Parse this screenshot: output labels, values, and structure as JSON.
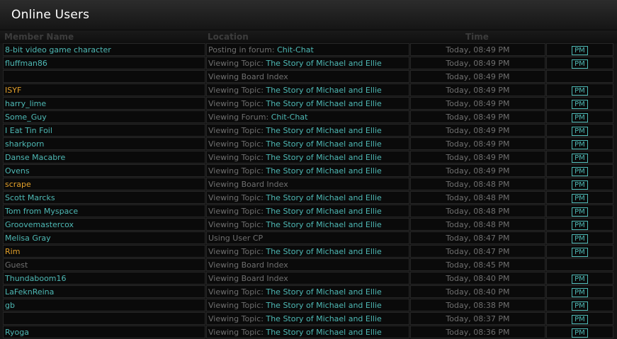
{
  "title": "Online Users",
  "columns": {
    "member": "Member Name",
    "location": "Location",
    "time": "Time"
  },
  "pm_label": "PM",
  "colors": {
    "accent": "#4eb9b5",
    "yellow": "#e3a02a",
    "blue": "#1b2fb9",
    "muted": "#6f6f6f"
  },
  "rows": [
    {
      "member": "8-bit video game character",
      "style": "teal",
      "action": "Posting in forum: ",
      "target": "Chit-Chat",
      "time": "Today, 08:49 PM",
      "pm": true
    },
    {
      "member": "fluffman86",
      "style": "teal",
      "action": "Viewing Topic: ",
      "target": "The Story of Michael and Ellie",
      "time": "Today, 08:49 PM",
      "pm": true
    },
    {
      "member": "",
      "style": "teal",
      "action": "Viewing Board Index",
      "target": "",
      "time": "Today, 08:49 PM",
      "pm": false
    },
    {
      "member": "ISYF",
      "style": "yellow",
      "action": "Viewing Topic: ",
      "target": "The Story of Michael and Ellie",
      "time": "Today, 08:49 PM",
      "pm": true
    },
    {
      "member": "harry_lime",
      "style": "teal",
      "action": "Viewing Topic: ",
      "target": "The Story of Michael and Ellie",
      "time": "Today, 08:49 PM",
      "pm": true
    },
    {
      "member": "Some_Guy",
      "style": "teal",
      "action": "Viewing Forum: ",
      "target": "Chit-Chat",
      "time": "Today, 08:49 PM",
      "pm": true
    },
    {
      "member": "I Eat Tin Foil",
      "style": "teal",
      "action": "Viewing Topic: ",
      "target": "The Story of Michael and Ellie",
      "time": "Today, 08:49 PM",
      "pm": true
    },
    {
      "member": "sharkporn",
      "style": "teal",
      "action": "Viewing Topic: ",
      "target": "The Story of Michael and Ellie",
      "time": "Today, 08:49 PM",
      "pm": true
    },
    {
      "member": "Danse Macabre",
      "style": "teal",
      "action": "Viewing Topic: ",
      "target": "The Story of Michael and Ellie",
      "time": "Today, 08:49 PM",
      "pm": true
    },
    {
      "member": "Ovens",
      "style": "teal",
      "action": "Viewing Topic: ",
      "target": "The Story of Michael and Ellie",
      "time": "Today, 08:49 PM",
      "pm": true
    },
    {
      "member": "scrape",
      "style": "yellow",
      "action": "Viewing Board Index",
      "target": "",
      "time": "Today, 08:48 PM",
      "pm": true
    },
    {
      "member": "Scott Marcks",
      "style": "teal",
      "action": "Viewing Topic: ",
      "target": "The Story of Michael and Ellie",
      "time": "Today, 08:48 PM",
      "pm": true
    },
    {
      "member": "Tom from Myspace",
      "style": "teal",
      "action": "Viewing Topic: ",
      "target": "The Story of Michael and Ellie",
      "time": "Today, 08:48 PM",
      "pm": true
    },
    {
      "member": "Groovemastercox",
      "style": "teal",
      "action": "Viewing Topic: ",
      "target": "The Story of Michael and Ellie",
      "time": "Today, 08:48 PM",
      "pm": true
    },
    {
      "member": "Melisa Gray",
      "style": "teal",
      "action": "Using User CP",
      "target": "",
      "time": "Today, 08:47 PM",
      "pm": true
    },
    {
      "member": "Rim",
      "style": "yellow",
      "action": "Viewing Topic: ",
      "target": "The Story of Michael and Ellie",
      "time": "Today, 08:47 PM",
      "pm": true
    },
    {
      "member": "Guest",
      "style": "guest",
      "action": "Viewing Board Index",
      "target": "",
      "time": "Today, 08:45 PM",
      "pm": false
    },
    {
      "member": "Thundaboom16",
      "style": "teal",
      "action": "Viewing Board Index",
      "target": "",
      "time": "Today, 08:40 PM",
      "pm": true
    },
    {
      "member": "LaFeknReina",
      "style": "teal",
      "action": "Viewing Topic: ",
      "target": "The Story of Michael and Ellie",
      "time": "Today, 08:40 PM",
      "pm": true
    },
    {
      "member": "gb",
      "style": "teal",
      "action": "Viewing Topic: ",
      "target": "The Story of Michael and Ellie",
      "time": "Today, 08:38 PM",
      "pm": true
    },
    {
      "member": "",
      "style": "blue",
      "action": "Viewing Topic: ",
      "target": "The Story of Michael and Ellie",
      "time": "Today, 08:37 PM",
      "pm": true
    },
    {
      "member": "Ryoga",
      "style": "teal",
      "action": "Viewing Topic: ",
      "target": "The Story of Michael and Ellie",
      "time": "Today, 08:36 PM",
      "pm": true
    }
  ]
}
